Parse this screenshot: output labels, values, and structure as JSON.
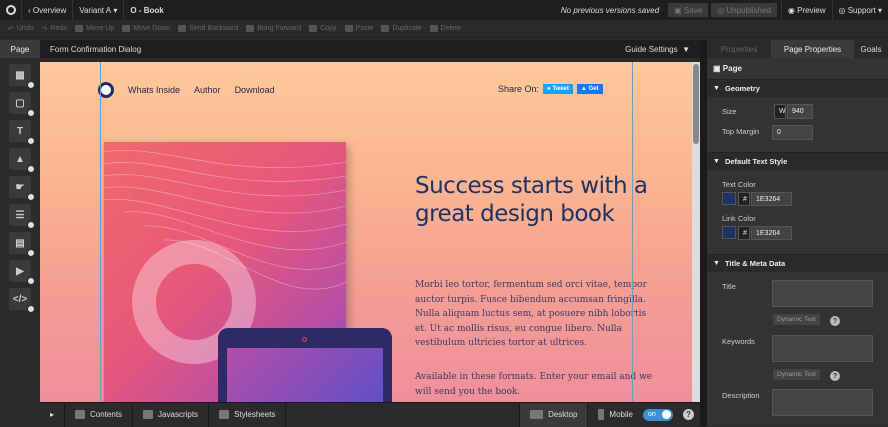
{
  "topbar": {
    "overview": "Overview",
    "variant": "Variant A",
    "page": "O - Book",
    "status": "No previous versions saved",
    "save": "Save",
    "unpublished": "Unpublished",
    "preview": "Preview",
    "support": "Support"
  },
  "toolbar": {
    "undo": "Undo",
    "redo": "Redo",
    "move_up": "Move Up",
    "move_down": "Move Down",
    "send_backward": "Send Backward",
    "bring_forward": "Bring Forward",
    "copy": "Copy",
    "paste": "Paste",
    "duplicate": "Duplicate",
    "delete": "Delete"
  },
  "canvas_header": {
    "page_tab": "Page",
    "dialog": "Form Confirmation Dialog",
    "guide": "Guide Settings"
  },
  "landing": {
    "nav": [
      "Whats Inside",
      "Author",
      "Download"
    ],
    "share_label": "Share On:",
    "tweet": "Tweet",
    "facebook": "Get",
    "headline": "Success starts with a great design book",
    "body1": "Morbi leo tortor, fermentum sed orci vitae, tempor auctor turpis. Fusce bibendum accumsan fringilla. Nulla aliquam luctus sem, at posuere nibh lobortis et. Ut ac mollis risus, eu congue libero. Nulla vestibulum ultricies tortor at ultrices.",
    "body2": "Available in these formats. Enter your email and we will send you the book."
  },
  "bottombar": {
    "contents": "Contents",
    "javascripts": "Javascripts",
    "stylesheets": "Stylesheets",
    "desktop": "Desktop",
    "mobile": "Mobile",
    "toggle": "on"
  },
  "panel": {
    "tabs": [
      "Properties",
      "Page Properties",
      "Goals"
    ],
    "page_label": "Page",
    "geometry": {
      "title": "Geometry",
      "size_label": "Size",
      "w": "W",
      "size": "940",
      "top_margin_label": "Top Margin",
      "top_margin": "0"
    },
    "text_style": {
      "title": "Default Text Style",
      "text_color_label": "Text Color",
      "text_color": "1E3264",
      "link_color_label": "Link Color",
      "link_color": "1E3264",
      "hash": "#"
    },
    "meta": {
      "title": "Title & Meta Data",
      "title_label": "Title",
      "keywords_label": "Keywords",
      "description_label": "Description",
      "dynamic_text": "Dynamic Text"
    }
  },
  "colors": {
    "accent": "#1e3264",
    "toggle": "#3a8fd8"
  }
}
